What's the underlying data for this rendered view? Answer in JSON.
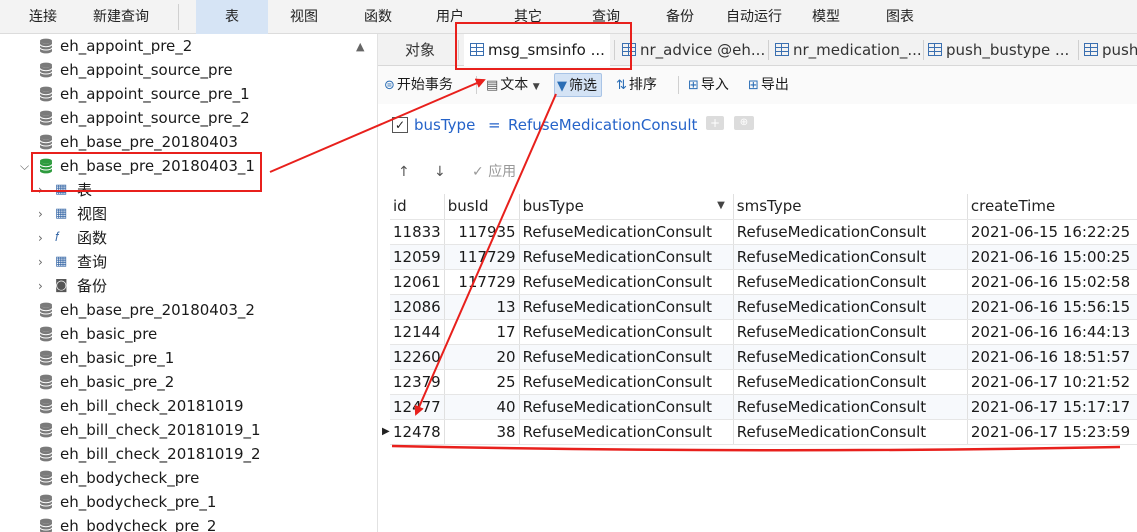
{
  "toolbar": {
    "items": [
      "连接",
      "新建查询",
      "表",
      "视图",
      "函数",
      "用户",
      "其它",
      "查询",
      "备份",
      "自动运行",
      "模型",
      "图表"
    ]
  },
  "navigator": {
    "items_before": [
      "eh_appoint_pre_2",
      "eh_appoint_source_pre",
      "eh_appoint_source_pre_1",
      "eh_appoint_source_pre_2",
      "eh_base_pre_20180403"
    ],
    "expanded": {
      "label": "eh_base_pre_20180403_1",
      "children": [
        "表",
        "视图",
        "函数",
        "查询",
        "备份"
      ]
    },
    "items_after": [
      "eh_base_pre_20180403_2",
      "eh_basic_pre",
      "eh_basic_pre_1",
      "eh_basic_pre_2",
      "eh_bill_check_20181019",
      "eh_bill_check_20181019_1",
      "eh_bill_check_20181019_2",
      "eh_bodycheck_pre",
      "eh_bodycheck_pre_1",
      "eh_bodycheck_pre_2"
    ],
    "colors": {
      "db_gray": "#7a7a7a",
      "db_green": "#2e9b3e"
    }
  },
  "tabs": {
    "objects": "对象",
    "items": [
      "msg_smsinfo ...",
      "nr_advice @eh...",
      "nr_medication_...",
      "push_bustype ...",
      "push"
    ]
  },
  "editor_toolbar": {
    "begin_tx": "开始事务",
    "text": "文本",
    "filter": "筛选",
    "sort": "排序",
    "import": "导入",
    "export": "导出"
  },
  "filter": {
    "field": "busType",
    "operator": "=",
    "value": "RefuseMedicationConsult"
  },
  "apply_bar": {
    "up": "↑",
    "down": "↓",
    "apply": "应用"
  },
  "grid": {
    "columns": [
      "id",
      "busId",
      "busType",
      "smsType",
      "createTime"
    ],
    "rows": [
      [
        "11833",
        "117935",
        "RefuseMedicationConsult",
        "RefuseMedicationConsult",
        "2021-06-15 16:22:25"
      ],
      [
        "12059",
        "117729",
        "RefuseMedicationConsult",
        "RefuseMedicationConsult",
        "2021-06-16 15:00:25"
      ],
      [
        "12061",
        "117729",
        "RefuseMedicationConsult",
        "RefuseMedicationConsult",
        "2021-06-16 15:02:58"
      ],
      [
        "12086",
        "13",
        "RefuseMedicationConsult",
        "RefuseMedicationConsult",
        "2021-06-16 15:56:15"
      ],
      [
        "12144",
        "17",
        "RefuseMedicationConsult",
        "RefuseMedicationConsult",
        "2021-06-16 16:44:13"
      ],
      [
        "12260",
        "20",
        "RefuseMedicationConsult",
        "RefuseMedicationConsult",
        "2021-06-16 18:51:57"
      ],
      [
        "12379",
        "25",
        "RefuseMedicationConsult",
        "RefuseMedicationConsult",
        "2021-06-17 10:21:52"
      ],
      [
        "12477",
        "40",
        "RefuseMedicationConsult",
        "RefuseMedicationConsult",
        "2021-06-17 15:17:17"
      ],
      [
        "12478",
        "38",
        "RefuseMedicationConsult",
        "RefuseMedicationConsult",
        "2021-06-17 15:23:59"
      ]
    ],
    "current_row_index": 8
  },
  "annotation_color": "#e8201c"
}
